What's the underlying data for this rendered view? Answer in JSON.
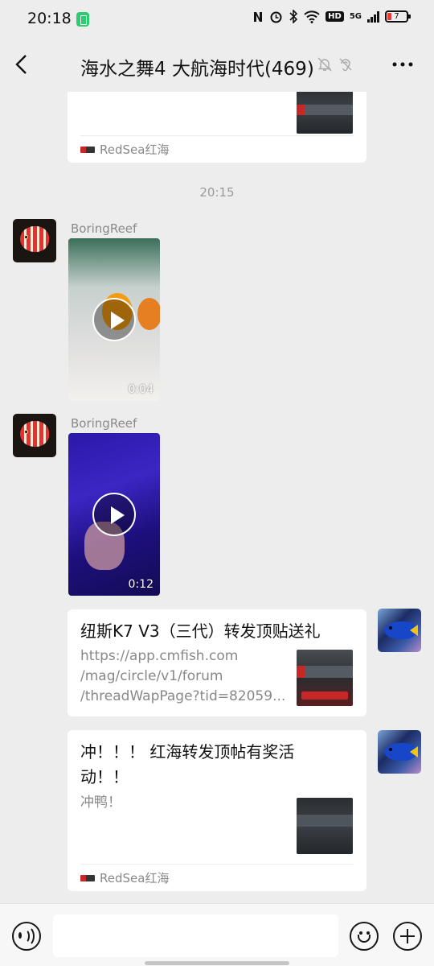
{
  "status_bar": {
    "time": "20:18",
    "network": "5G",
    "hd_badge": "HD",
    "battery_level": "7",
    "icons": [
      "nfc-icon",
      "alarm-icon",
      "bluetooth-icon",
      "wifi-icon",
      "hd-icon",
      "signal-icon",
      "battery-icon"
    ]
  },
  "header": {
    "title": "海水之舞4 大航海时代(469)",
    "icons": [
      "back-icon",
      "mute-icon",
      "ear-icon",
      "more-icon"
    ]
  },
  "messages": {
    "top_card": {
      "source": "RedSea红海"
    },
    "timestamp": "20:15",
    "video_1": {
      "sender": "BoringReef",
      "duration": "0:04"
    },
    "video_2": {
      "sender": "BoringReef",
      "duration": "0:12"
    },
    "link_card": {
      "title": "纽斯K7 V3（三代）转发顶贴送礼",
      "url_line_1": "https://app.cmfish.com",
      "url_line_2": "/mag/circle/v1/forum",
      "url_line_3": "/threadWapPage?tid=82059..."
    },
    "share_card": {
      "title_line_1": "冲！！！ 红海转发顶帖有奖活",
      "title_line_2": "动！！",
      "description": "冲鸭！",
      "source": "RedSea红海"
    }
  },
  "input_bar": {
    "placeholder": ""
  },
  "colors": {
    "background": "#ededed",
    "bubble": "#ffffff",
    "accent_red": "#e7302f"
  }
}
